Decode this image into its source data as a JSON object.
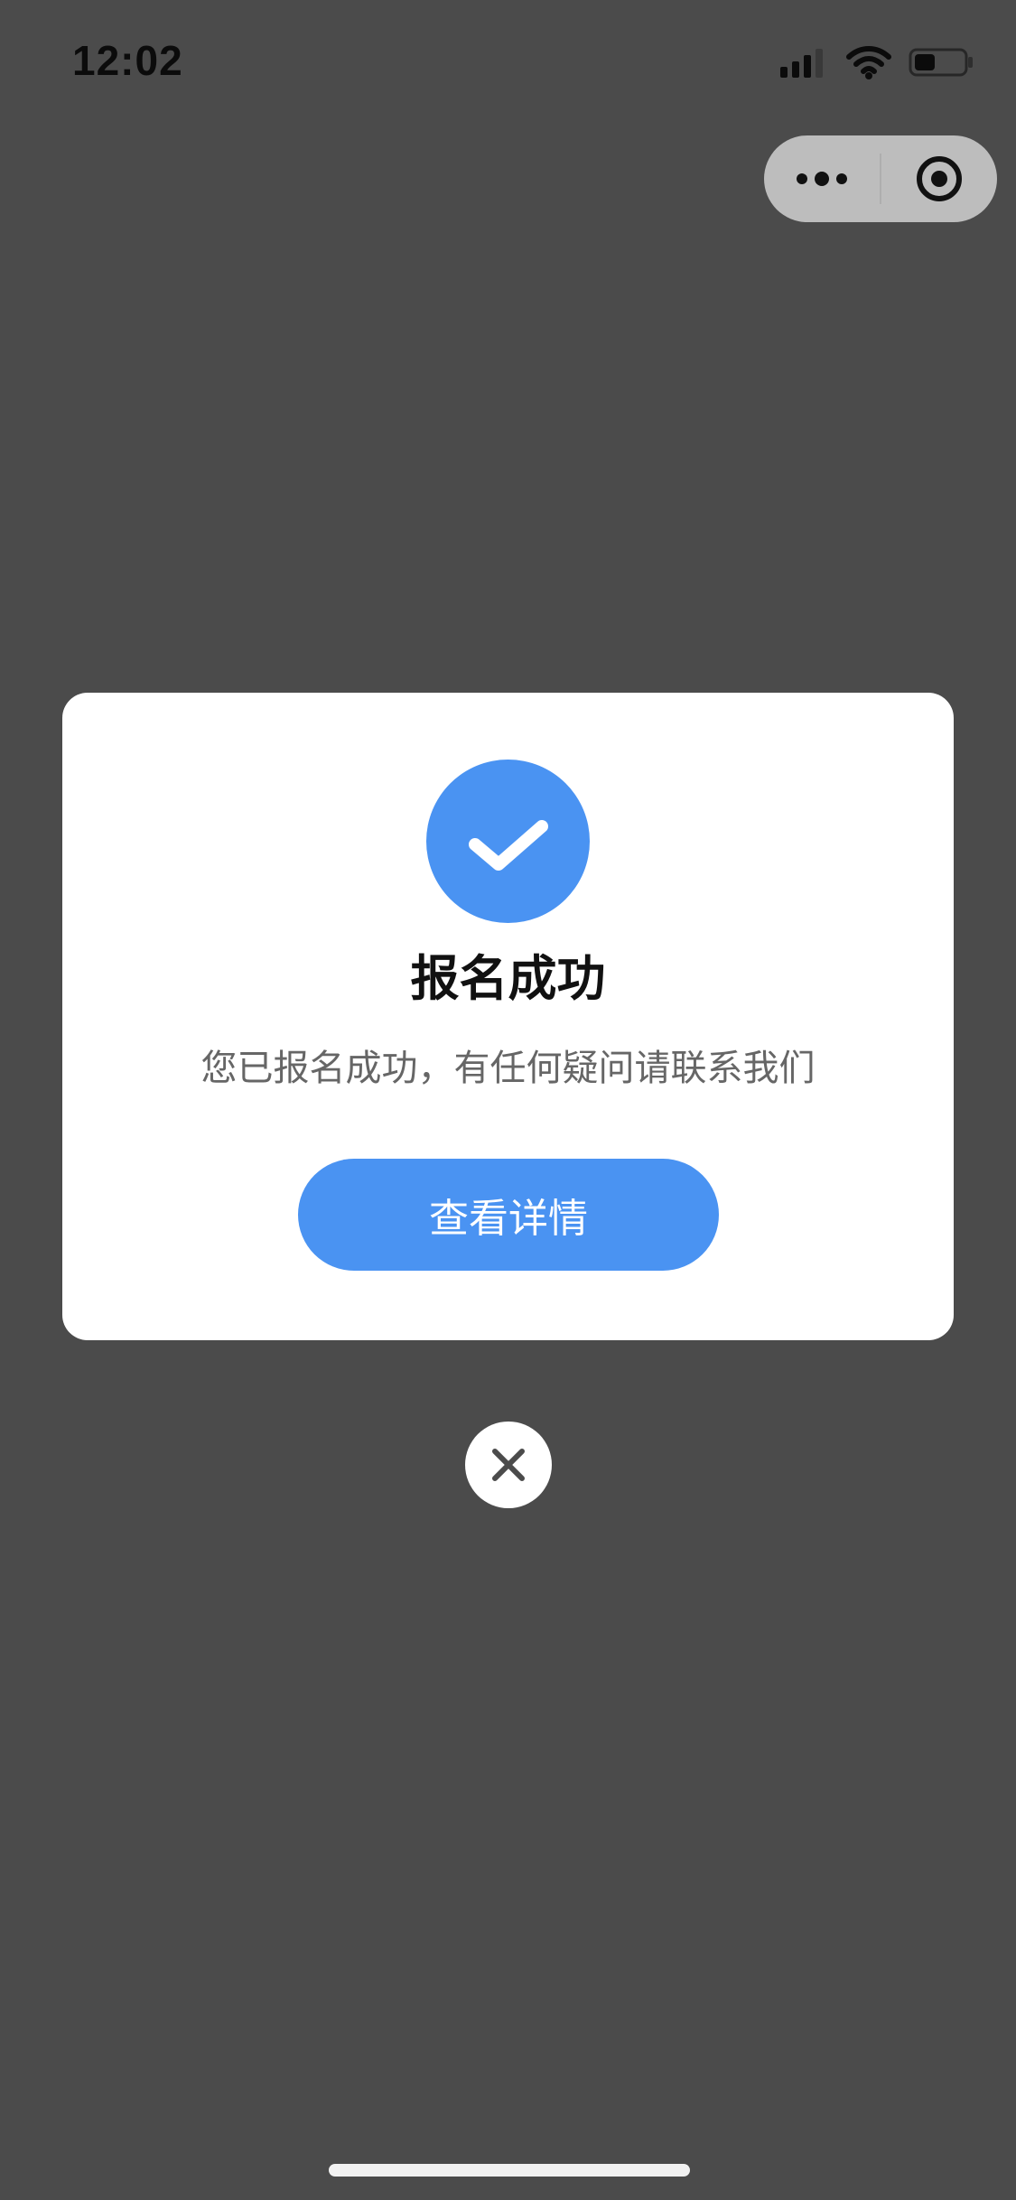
{
  "status_bar": {
    "time": "12:02",
    "icons": [
      "signal-icon",
      "wifi-icon",
      "battery-icon"
    ]
  },
  "capsule": {
    "more_icon": "more-dots-icon",
    "target_icon": "target-icon"
  },
  "modal": {
    "icon": "check-icon",
    "title": "报名成功",
    "message": "您已报名成功，有任何疑问请联系我们",
    "button_label": "查看详情"
  },
  "close": {
    "icon": "close-icon"
  },
  "colors": {
    "overlay": "#4b4b4b",
    "accent": "#4a93f2",
    "modal_bg": "#ffffff",
    "text_secondary": "#666666"
  }
}
